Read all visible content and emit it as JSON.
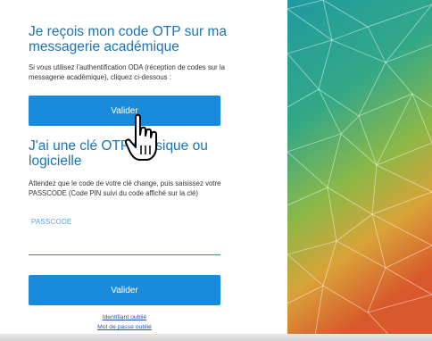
{
  "otp_mail": {
    "title": "Je reçois mon code OTP sur ma\nmessagerie académique",
    "description": "Si vous utilisez l'authentification ODA (réception de codes sur la messagerie académique), cliquez ci-dessous :",
    "button_label": "Valider"
  },
  "otp_key": {
    "title": "J'ai une clé OTP physique ou\nlogicielle",
    "description": "Attendez que le code de votre clé change, puis saisissez votre PASSCODE (Code PIN suivi du code affiché sur la clé)",
    "passcode_label": "PASSCODE",
    "passcode_value": "",
    "button_label": "Valider"
  },
  "links": {
    "forgot_id": "Identifiant oublié",
    "forgot_password": "Mot de passe oublié"
  },
  "colors": {
    "heading": "#1a74b8",
    "button": "#1a8bdc",
    "link": "#2255aa"
  },
  "icons": {
    "cursor": "hand-pointer-icon"
  }
}
